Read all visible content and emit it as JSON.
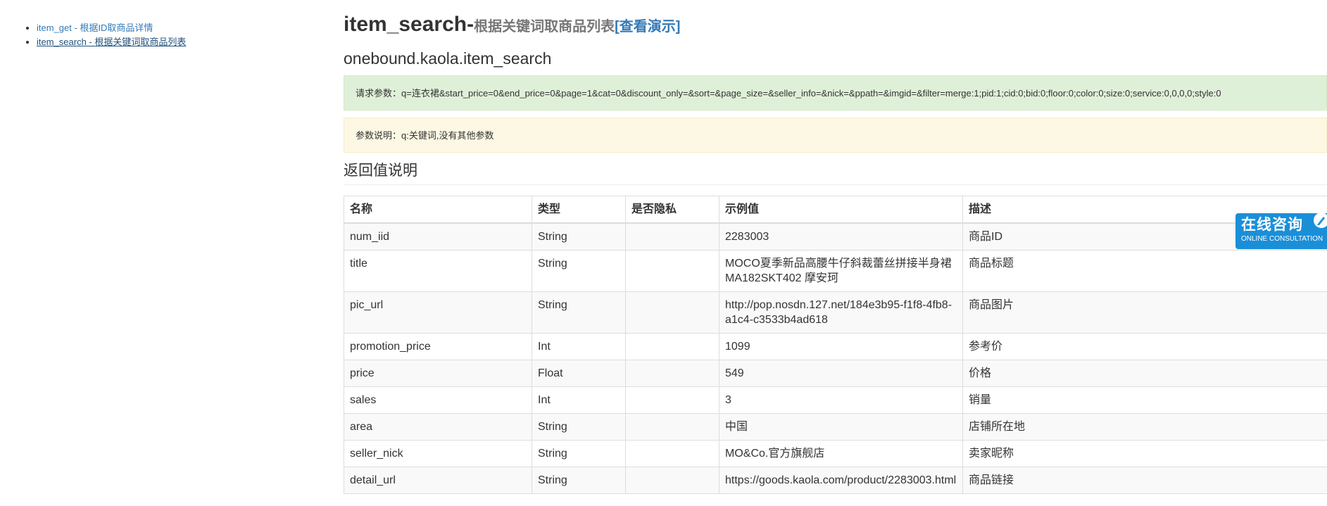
{
  "sidebar": {
    "items": [
      {
        "label": "item_get - 根据ID取商品详情",
        "active": false
      },
      {
        "label": "item_search - 根据关键词取商品列表",
        "active": true
      }
    ]
  },
  "header": {
    "method": "item_search-",
    "description": "根据关键词取商品列表",
    "demo_link": "[查看演示]",
    "api_name": "onebound.kaola.item_search"
  },
  "request_params": "请求参数：q=连衣裙&start_price=0&end_price=0&page=1&cat=0&discount_only=&sort=&page_size=&seller_info=&nick=&ppath=&imgid=&filter=merge:1;pid:1;cid:0;bid:0;floor:0;color:0;size:0;service:0,0,0,0;style:0",
  "param_notes": "参数说明：q:关键词,没有其他参数",
  "section_title": "返回值说明",
  "table": {
    "headers": [
      "名称",
      "类型",
      "是否隐私",
      "示例值",
      "描述"
    ],
    "rows": [
      [
        "num_iid",
        "String",
        "",
        "2283003",
        "商品ID"
      ],
      [
        "title",
        "String",
        "",
        "MOCO夏季新品高腰牛仔斜裁蕾丝拼接半身裙MA182SKT402 摩安珂",
        "商品标题"
      ],
      [
        "pic_url",
        "String",
        "",
        "http://pop.nosdn.127.net/184e3b95-f1f8-4fb8-a1c4-c3533b4ad618",
        "商品图片"
      ],
      [
        "promotion_price",
        "Int",
        "",
        "1099",
        "参考价"
      ],
      [
        "price",
        "Float",
        "",
        "549",
        "价格"
      ],
      [
        "sales",
        "Int",
        "",
        "3",
        "销量"
      ],
      [
        "area",
        "String",
        "",
        "中国",
        "店铺所在地"
      ],
      [
        "seller_nick",
        "String",
        "",
        "MO&Co.官方旗舰店",
        "卖家昵称"
      ],
      [
        "detail_url",
        "String",
        "",
        "https://goods.kaola.com/product/2283003.html",
        "商品链接"
      ]
    ]
  },
  "consult": {
    "title": "在线咨询",
    "subtitle": "ONLINE CONSULTATION",
    "icon": "pen-icon"
  }
}
